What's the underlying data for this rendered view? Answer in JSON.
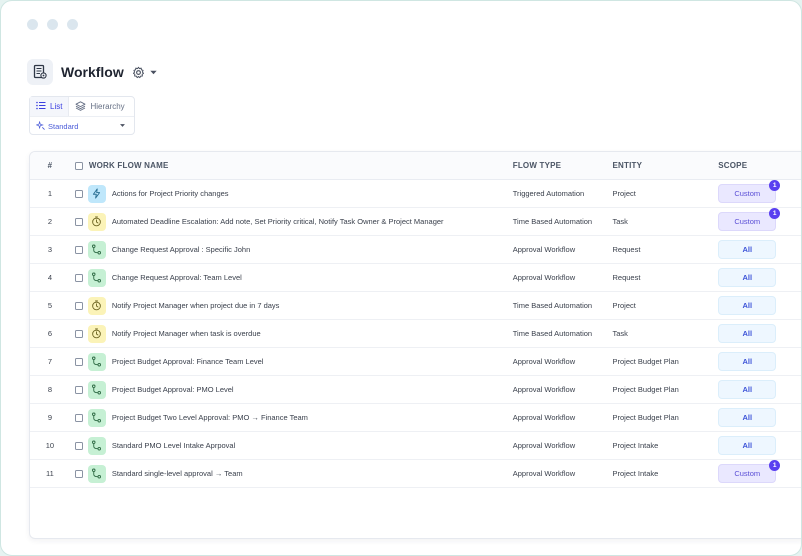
{
  "header": {
    "title": "Workflow"
  },
  "view": {
    "tabs": [
      {
        "label": "List",
        "icon": "list-icon",
        "active": true
      },
      {
        "label": "Hierarchy",
        "icon": "layers-icon",
        "active": false
      }
    ],
    "selected_view": "Standard"
  },
  "table": {
    "columns": {
      "num": "#",
      "name": "WORK FLOW NAME",
      "type": "FLOW TYPE",
      "entity": "ENTITY",
      "scope": "SCOPE"
    },
    "rows": [
      {
        "num": "1",
        "name": "Actions for Project Priority changes",
        "type": "Triggered Automation",
        "entity": "Project",
        "scope": "Custom",
        "badge": "1",
        "icon": "bolt-icon"
      },
      {
        "num": "2",
        "name": "Automated Deadline Escalation: Add note, Set Priority critical, Notify Task Owner & Project Manager",
        "type": "Time Based Automation",
        "entity": "Task",
        "scope": "Custom",
        "badge": "1",
        "icon": "clock-icon"
      },
      {
        "num": "3",
        "name": "Change Request Approval : Specific John",
        "type": "Approval Workflow",
        "entity": "Request",
        "scope": "All",
        "icon": "branch-icon"
      },
      {
        "num": "4",
        "name": "Change Request Approval: Team Level",
        "type": "Approval Workflow",
        "entity": "Request",
        "scope": "All",
        "icon": "branch-icon"
      },
      {
        "num": "5",
        "name": "Notify Project Manager when project due in 7 days",
        "type": "Time Based Automation",
        "entity": "Project",
        "scope": "All",
        "icon": "clock-icon"
      },
      {
        "num": "6",
        "name": "Notify Project Manager when task is overdue",
        "type": "Time Based Automation",
        "entity": "Task",
        "scope": "All",
        "icon": "clock-icon"
      },
      {
        "num": "7",
        "name": "Project Budget Approval: Finance Team Level",
        "type": "Approval Workflow",
        "entity": "Project Budget Plan",
        "scope": "All",
        "icon": "branch-icon"
      },
      {
        "num": "8",
        "name": "Project Budget Approval: PMO Level",
        "type": "Approval Workflow",
        "entity": "Project Budget Plan",
        "scope": "All",
        "icon": "branch-icon"
      },
      {
        "num": "9",
        "name": "Project Budget Two Level Approval: PMO → Finance Team",
        "type": "Approval Workflow",
        "entity": "Project Budget Plan",
        "scope": "All",
        "icon": "branch-icon"
      },
      {
        "num": "10",
        "name": "Standard PMO Level Intake Aprpoval",
        "type": "Approval Workflow",
        "entity": "Project Intake",
        "scope": "All",
        "icon": "branch-icon"
      },
      {
        "num": "11",
        "name": "Standard single-level approval → Team",
        "type": "Approval Workflow",
        "entity": "Project Intake",
        "scope": "Custom",
        "badge": "1",
        "icon": "branch-icon"
      }
    ]
  }
}
